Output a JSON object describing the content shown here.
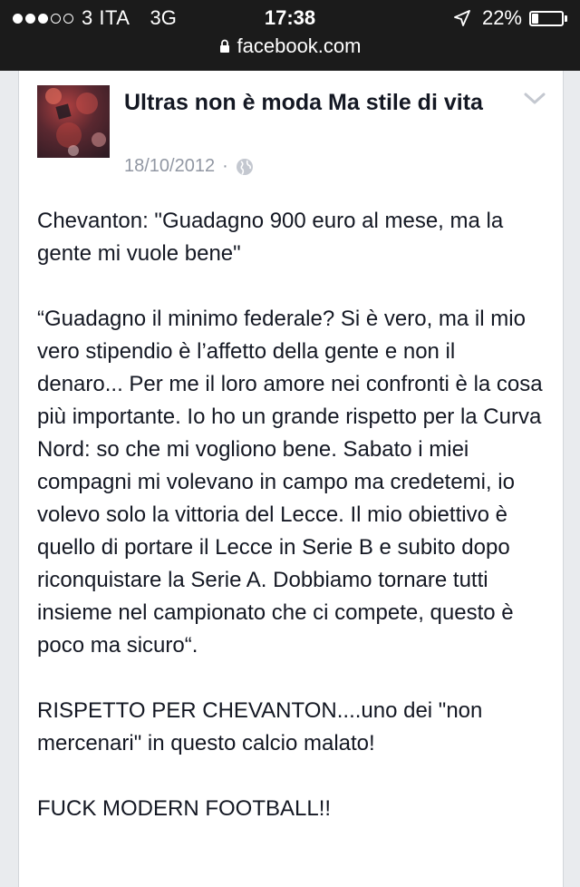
{
  "status_bar": {
    "signal_dots": [
      true,
      true,
      true,
      false,
      false
    ],
    "carrier": "3 ITA",
    "network": "3G",
    "time": "17:38",
    "battery_percent_text": "22%",
    "battery_level": 0.22
  },
  "browser": {
    "url": "facebook.com"
  },
  "post": {
    "author": "Ultras non è moda Ma stile di vita",
    "date": "18/10/2012",
    "meta_separator": "·",
    "privacy_icon": "globe-icon",
    "menu_icon": "chevron-down-icon",
    "paragraphs": [
      "Chevanton: \"Guadagno 900 euro al mese, ma la gente mi vuole bene\"",
      "“Guadagno il minimo federale? Si è vero, ma il mio vero stipendio è l’affetto della gente e non il denaro... Per me il loro amore nei confronti è la cosa più importante. Io ho un grande rispetto per la Curva Nord: so che mi vogliono bene. Sabato i miei compagni mi volevano in campo ma credetemi, io volevo solo la vittoria del Lecce. Il mio obiettivo è quello di portare il Lecce in Serie B e subito dopo riconquistare la Serie A. Dobbiamo tornare tutti insieme nel campionato che ci compete, questo è poco ma sicuro“.",
      "RISPETTO PER CHEVANTON....uno dei \"non mercenari\" in questo calcio malato!",
      "FUCK MODERN FOOTBALL!!"
    ]
  },
  "colors": {
    "status_bar_bg": "#1b1b1b",
    "page_bg": "#e9ebee",
    "card_bg": "#ffffff",
    "text": "#141823",
    "meta_text": "#9197a3"
  }
}
